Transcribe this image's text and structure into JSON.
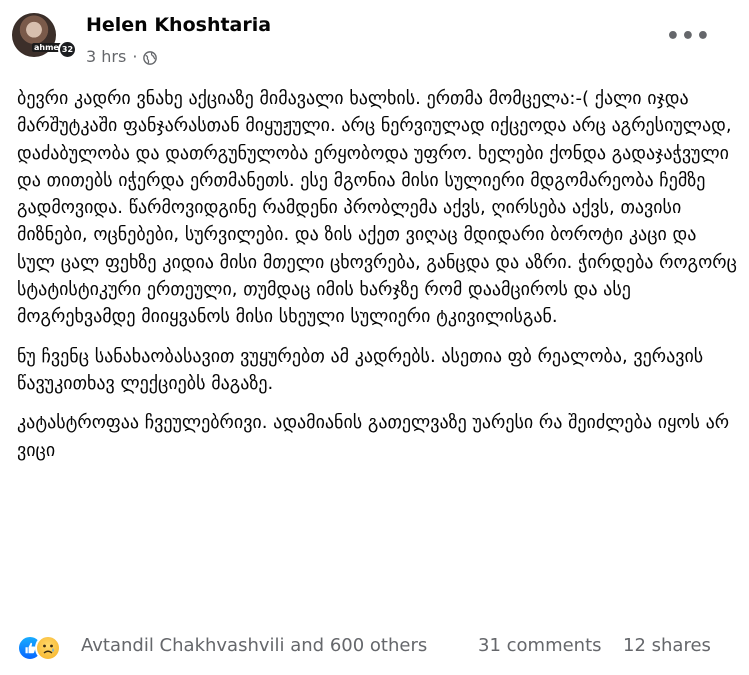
{
  "post": {
    "author": "Helen Khoshtaria",
    "time": "3 hrs",
    "separator": "·",
    "avatar_badge": "ahmes!",
    "avatar_count": "32",
    "more_icon": "•••",
    "paragraphs": [
      "ბევრი კადრი ვნახე აქციაზე მიმავალი ხალხის. ერთმა მომცელა:-( ქალი იჯდა მარშუტკაში ფანჯარასთან მიყუჟული. არც ნერვიულად იქცეოდა არც აგრესიულად, დაძაბულობა და დათრგუნულობა ერყობოდა უფრო. ხელები ქონდა გადაჯაჭვული და თითებს იჭერდა ერთმანეთს. ესე მგონია მისი სულიერი მდგომარეობა ჩემზე გადმოვიდა. წარმოვიდგინე რამდენი პრობლემა აქვს, ღირსება აქვს, თავისი მიზნები, ოცნებები, სურვილები. და ზის აქეთ ვიღაც მდიდარი ბოროტი კაცი და სულ ცალ ფეხზე კიდია მისი მთელი ცხოვრება, განცდა და აზრი. ჭირდება როგორც სტატისტიკური ერთეული, თუმდაც იმის ხარჯზე რომ დაამციროს და ასე მოგრეხვამდე მიიყვანოს მისი სხეული სულიერი ტკივილისგან.",
      "ნუ ჩვენც სანახაობასავით ვუყურებთ ამ კადრებს. ასეთია ფბ რეალობა, ვერავის წავუკითხავ ლექციებს მაგაზე.",
      "კატასტროფაა ჩვეულებრივი. ადამიანის გათელვაზე უარესი რა შეიძლება იყოს არ ვიცი"
    ],
    "reactors": "Avtandil Chakhvashvili and 600 others",
    "comments": "31 comments",
    "shares": "12 shares",
    "colors": {
      "text": "#050505",
      "muted": "#65676b",
      "like": "#0866ff",
      "sad": "#f7b125"
    },
    "icons": [
      "globe-icon",
      "more-icon",
      "like-reaction-icon",
      "sad-reaction-icon"
    ]
  }
}
